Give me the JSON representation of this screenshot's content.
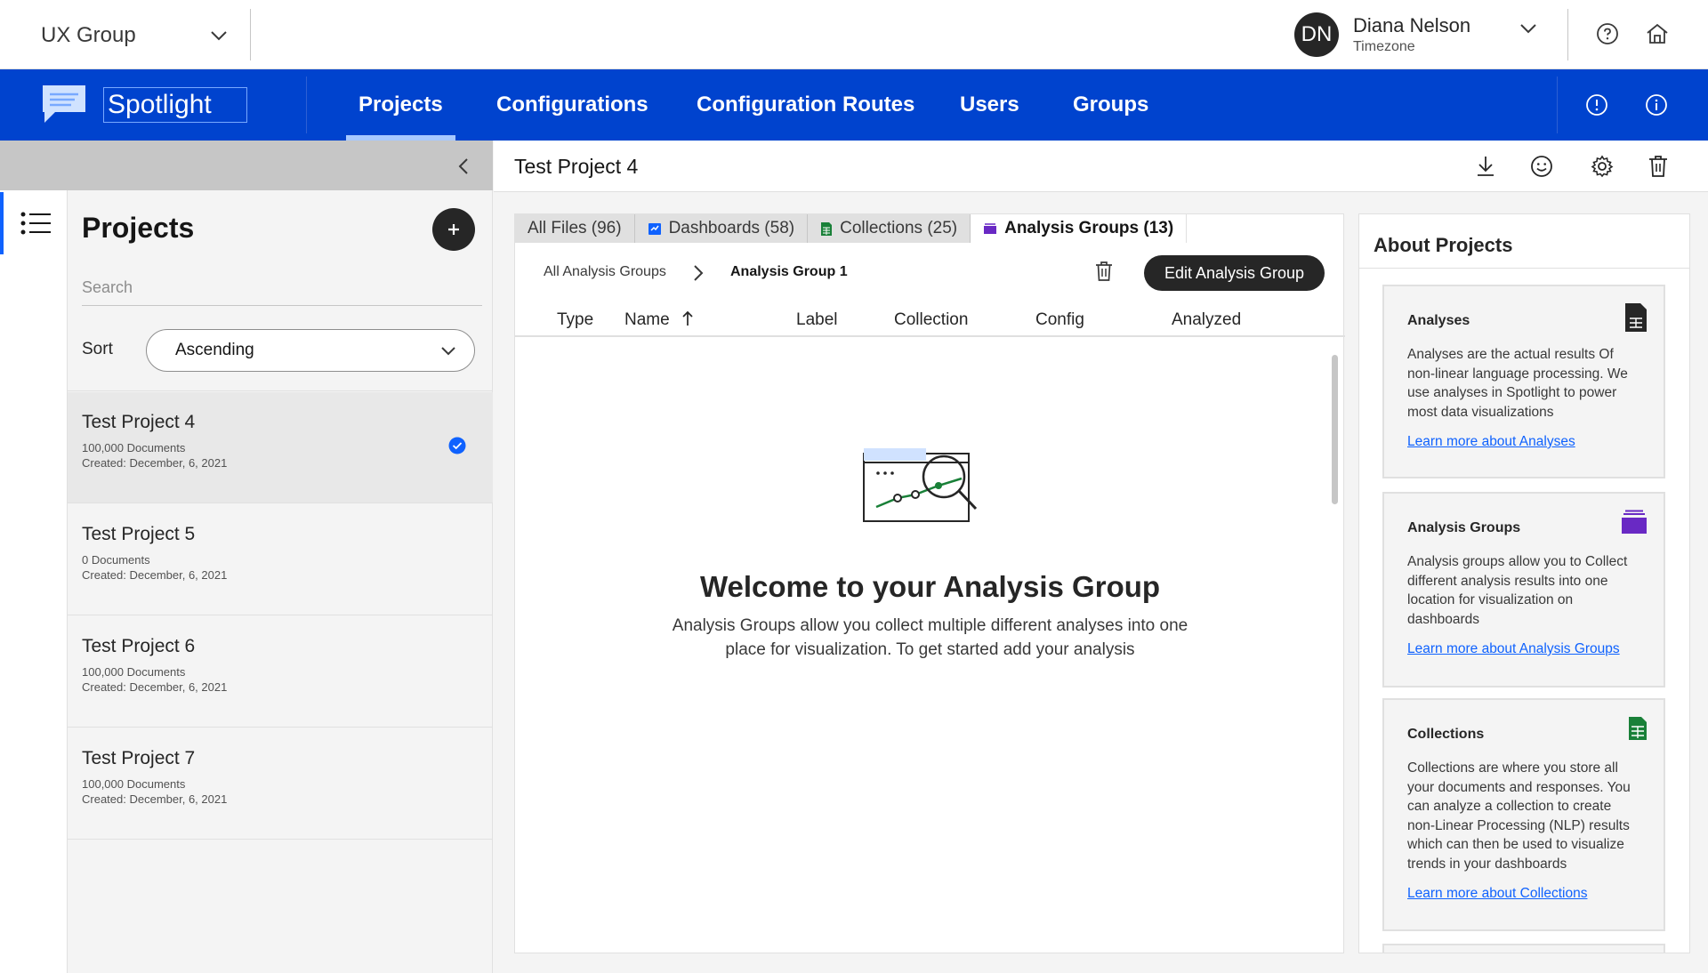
{
  "topbar": {
    "org": "UX Group",
    "user_initials": "DN",
    "user_name": "Diana Nelson",
    "user_sub": "Timezone"
  },
  "nav": {
    "brand": "Spotlight",
    "items": [
      "Projects",
      "Configurations",
      "Configuration Routes",
      "Users",
      "Groups"
    ],
    "active": "Projects"
  },
  "sidebar": {
    "title": "Projects",
    "search_placeholder": "Search",
    "sort_label": "Sort",
    "sort_value": "Ascending",
    "projects": [
      {
        "name": "Test Project 4",
        "docs": "100,000 Documents",
        "created": "Created: December, 6, 2021",
        "selected": true
      },
      {
        "name": "Test Project 5",
        "docs": "0 Documents",
        "created": "Created: December, 6, 2021"
      },
      {
        "name": "Test Project 6",
        "docs": "100,000 Documents",
        "created": "Created: December, 6, 2021"
      },
      {
        "name": "Test Project 7",
        "docs": "100,000 Documents",
        "created": "Created: December, 6, 2021"
      }
    ]
  },
  "content": {
    "title": "Test Project 4",
    "tabs": [
      "All Files (96)",
      "Dashboards (58)",
      "Collections (25)",
      "Analysis Groups (13)"
    ],
    "breadcrumb": [
      "All Analysis Groups",
      "Analysis Group 1"
    ],
    "edit_button": "Edit Analysis Group",
    "columns": [
      "Type",
      "Name",
      "Label",
      "Collection",
      "Config",
      "Analyzed"
    ],
    "welcome_title": "Welcome to your Analysis Group",
    "welcome_text": "Analysis Groups allow you collect multiple different analyses into one place for visualization. To get started add your analysis"
  },
  "about": {
    "title": "About Projects",
    "cards": [
      {
        "title": "Analyses",
        "text": "Analyses are the actual results Of non-linear language processing. We use analyses in Spotlight to power most data visualizations",
        "link": "Learn more about Analyses",
        "icon": "document-icon"
      },
      {
        "title": "Analysis Groups",
        "text": "Analysis groups allow you to Collect different analysis results into one location for visualization on dashboards",
        "link": "Learn more about Analysis Groups",
        "icon": "folder-stack-icon"
      },
      {
        "title": "Collections",
        "text": "Collections are where you store all your documents and responses. You can analyze a collection to create non-Linear Processing (NLP) results which can then be used to visualize trends in your dashboards",
        "link": "Learn more about Collections",
        "icon": "spreadsheet-icon"
      }
    ]
  },
  "colors": {
    "nav_blue": "#0043ce",
    "accent": "#0f62fe",
    "analysis_purple": "#6929c4",
    "collection_green": "#198038"
  }
}
